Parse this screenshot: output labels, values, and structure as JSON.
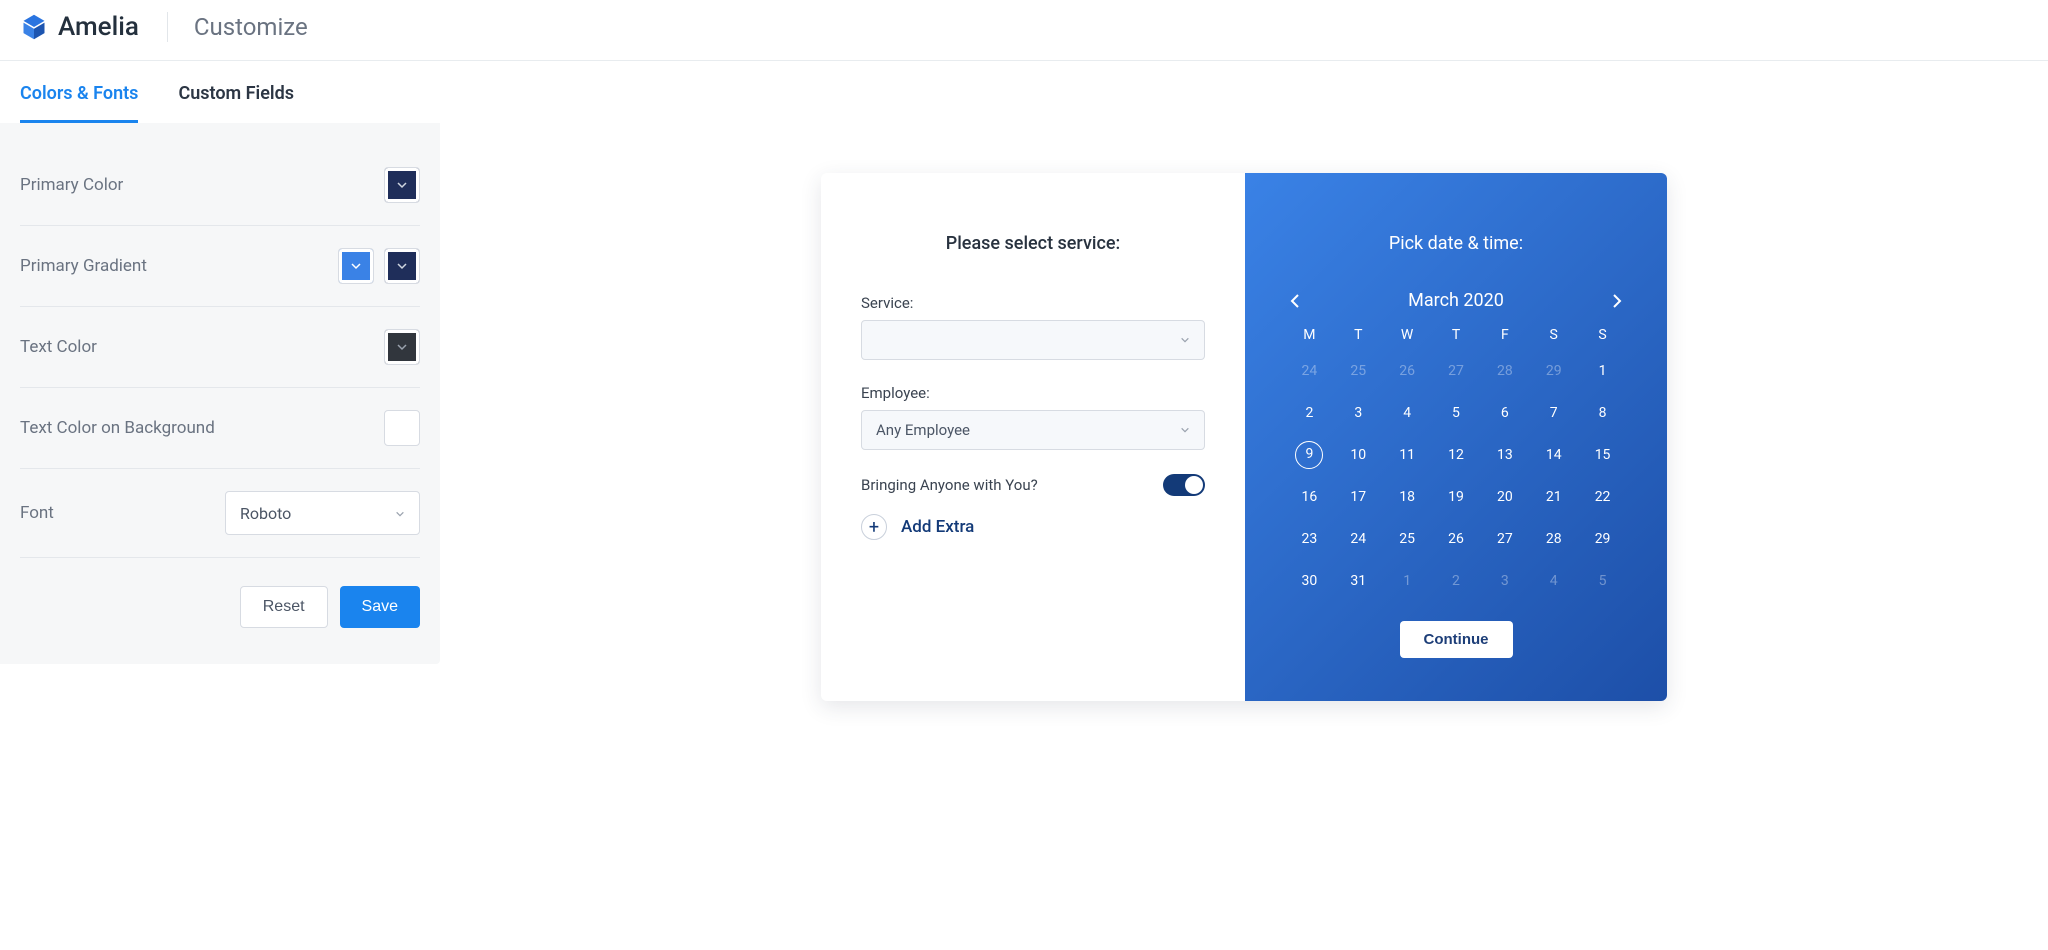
{
  "header": {
    "brand": "Amelia",
    "page_title": "Customize"
  },
  "tabs": {
    "colors_fonts": "Colors & Fonts",
    "custom_fields": "Custom Fields"
  },
  "sidebar": {
    "primary_color": {
      "label": "Primary Color",
      "value": "#1F2E5A"
    },
    "primary_gradient": {
      "label": "Primary Gradient",
      "from": "#3A82E6",
      "to": "#1F2E5A"
    },
    "text_color": {
      "label": "Text Color",
      "value": "#31363D"
    },
    "text_on_bg": {
      "label": "Text Color on Background",
      "value": "#FFFFFF"
    },
    "font": {
      "label": "Font",
      "value": "Roboto"
    },
    "reset": "Reset",
    "save": "Save"
  },
  "preview": {
    "left_title": "Please select service:",
    "service_label": "Service:",
    "service_value": "",
    "employee_label": "Employee:",
    "employee_value": "Any Employee",
    "bringing_label": "Bringing Anyone with You?",
    "bringing_on": true,
    "add_extra": "Add Extra",
    "right_title": "Pick date & time:",
    "month": "March 2020",
    "dow": [
      "M",
      "T",
      "W",
      "T",
      "F",
      "S",
      "S"
    ],
    "weeks": [
      [
        {
          "n": "24",
          "dim": true
        },
        {
          "n": "25",
          "dim": true
        },
        {
          "n": "26",
          "dim": true
        },
        {
          "n": "27",
          "dim": true
        },
        {
          "n": "28",
          "dim": true
        },
        {
          "n": "29",
          "dim": true
        },
        {
          "n": "1"
        }
      ],
      [
        {
          "n": "2"
        },
        {
          "n": "3"
        },
        {
          "n": "4"
        },
        {
          "n": "5"
        },
        {
          "n": "6"
        },
        {
          "n": "7"
        },
        {
          "n": "8"
        }
      ],
      [
        {
          "n": "9",
          "selected": true
        },
        {
          "n": "10"
        },
        {
          "n": "11"
        },
        {
          "n": "12"
        },
        {
          "n": "13"
        },
        {
          "n": "14"
        },
        {
          "n": "15"
        }
      ],
      [
        {
          "n": "16"
        },
        {
          "n": "17"
        },
        {
          "n": "18"
        },
        {
          "n": "19"
        },
        {
          "n": "20"
        },
        {
          "n": "21"
        },
        {
          "n": "22"
        }
      ],
      [
        {
          "n": "23"
        },
        {
          "n": "24"
        },
        {
          "n": "25"
        },
        {
          "n": "26"
        },
        {
          "n": "27"
        },
        {
          "n": "28"
        },
        {
          "n": "29"
        }
      ],
      [
        {
          "n": "30"
        },
        {
          "n": "31"
        },
        {
          "n": "1",
          "dim": true
        },
        {
          "n": "2",
          "dim": true
        },
        {
          "n": "3",
          "dim": true
        },
        {
          "n": "4",
          "dim": true
        },
        {
          "n": "5",
          "dim": true
        }
      ]
    ],
    "continue": "Continue"
  }
}
